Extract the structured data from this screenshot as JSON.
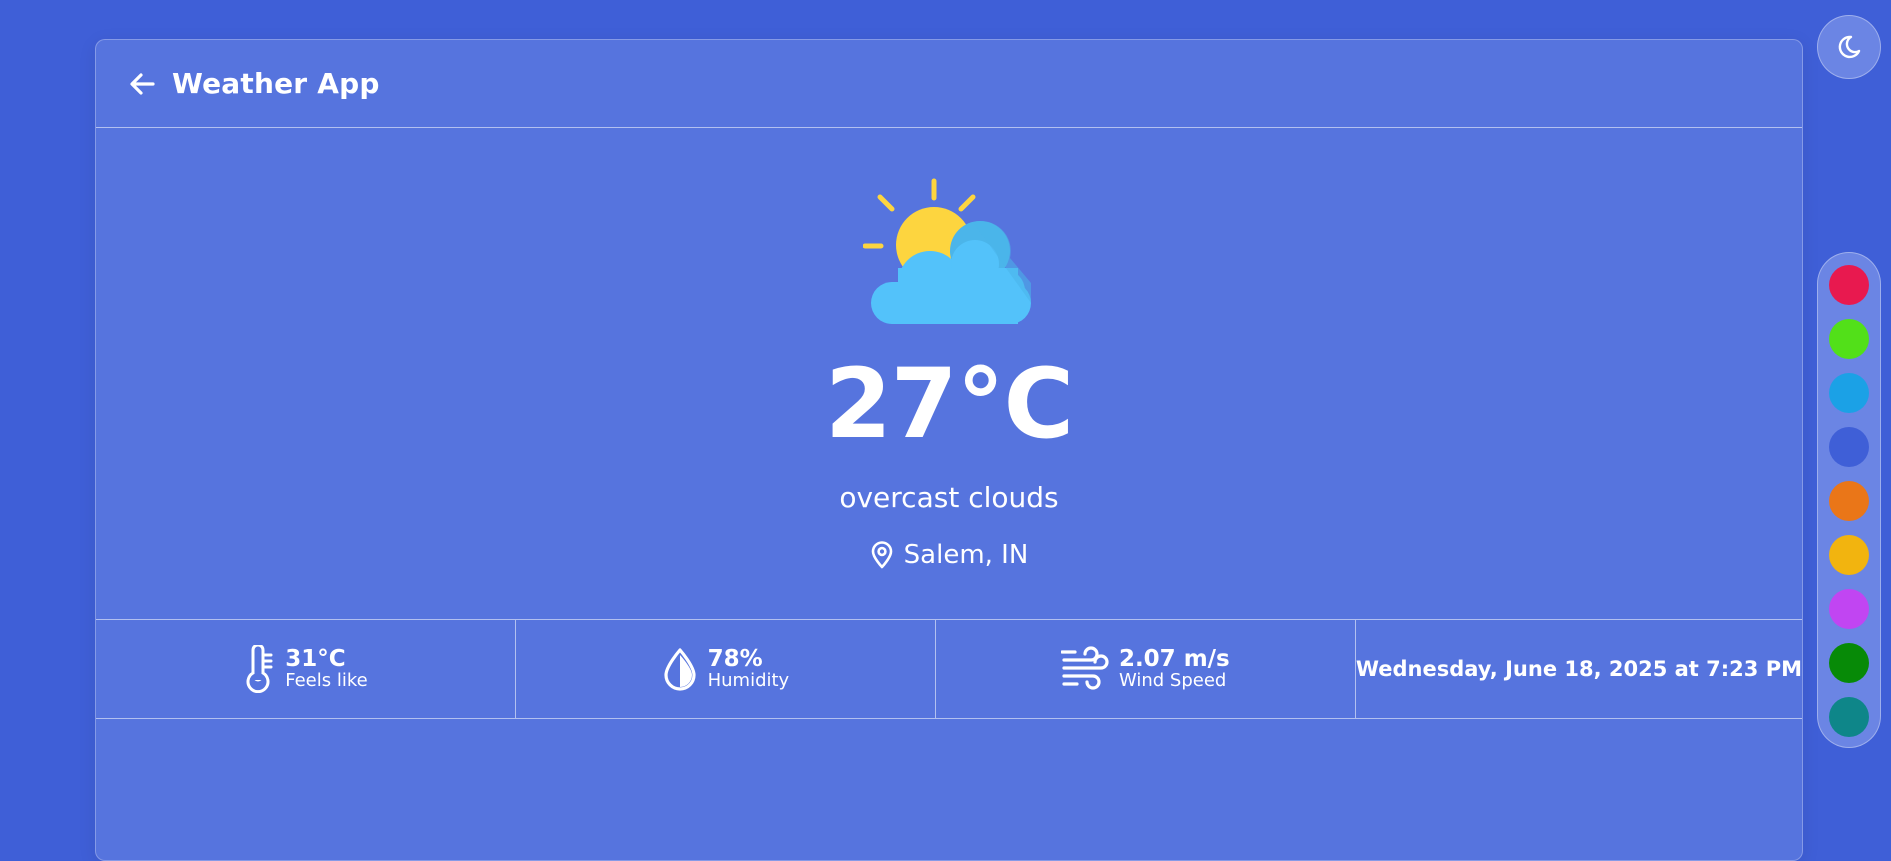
{
  "header": {
    "title": "Weather App",
    "back_icon": "arrow-left-icon"
  },
  "weather": {
    "icon": "partly-cloudy-icon",
    "temperature": "27°C",
    "condition": "overcast clouds",
    "location": "Salem, IN",
    "location_icon": "map-pin-icon"
  },
  "stats": {
    "feels_like": {
      "value": "31°C",
      "label": "Feels like",
      "icon": "thermometer-icon"
    },
    "humidity": {
      "value": "78%",
      "label": "Humidity",
      "icon": "droplet-icon"
    },
    "wind": {
      "value": "2.07 m/s",
      "label": "Wind Speed",
      "icon": "wind-icon"
    },
    "datetime": "Wednesday, June 18, 2025 at 7:23 PM"
  },
  "theme_toggle": {
    "icon": "moon-icon"
  },
  "palette": {
    "colors": [
      "#e8194f",
      "#52e019",
      "#1ba1e6",
      "#3f5fd7",
      "#ea7618",
      "#f2b40f",
      "#c145f2",
      "#078a07",
      "#0e8689"
    ]
  }
}
